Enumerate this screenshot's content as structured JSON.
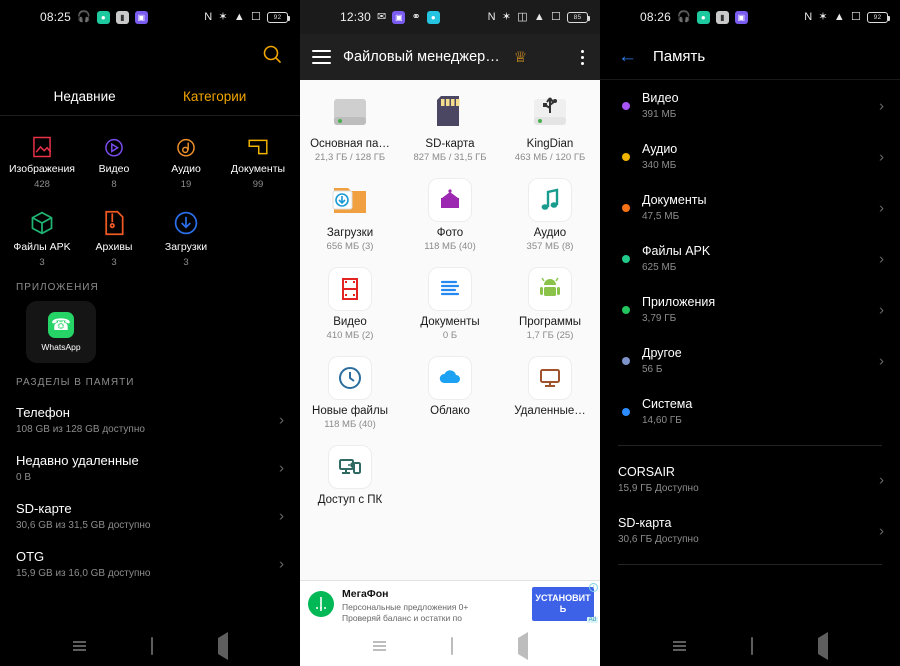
{
  "panel1": {
    "status": {
      "time": "08:25",
      "battery": "92",
      "left_icons": [
        "headphone-icon",
        "spotify-chip",
        "mail-chip",
        "app-chip"
      ],
      "right_icons": [
        "nfc-icon",
        "bluetooth-icon",
        "wifi-icon",
        "screenshot-icon",
        "battery-icon"
      ]
    },
    "search_label": "search-icon",
    "tabs": [
      {
        "label": "Недавние",
        "active": false
      },
      {
        "label": "Категории",
        "active": true
      }
    ],
    "categories": [
      {
        "label": "Изображения",
        "count": "428",
        "color": "#e8334a",
        "icon": "image-icon"
      },
      {
        "label": "Видео",
        "count": "8",
        "color": "#7a4df0",
        "icon": "video-icon"
      },
      {
        "label": "Аудио",
        "count": "19",
        "color": "#f0902a",
        "icon": "audio-icon"
      },
      {
        "label": "Документы",
        "count": "99",
        "color": "#f0b400",
        "icon": "document-icon"
      },
      {
        "label": "Файлы APK",
        "count": "3",
        "color": "#1fb472",
        "icon": "apk-icon"
      },
      {
        "label": "Архивы",
        "count": "3",
        "color": "#f05a22",
        "icon": "archive-icon"
      },
      {
        "label": "Загрузки",
        "count": "3",
        "color": "#2b6fe8",
        "icon": "download-icon"
      }
    ],
    "apps_header": "ПРИЛОЖЕНИЯ",
    "apps": [
      {
        "name": "WhatsApp",
        "icon": "whatsapp-icon",
        "color": "#25D366"
      }
    ],
    "storage_header": "РАЗДЕЛЫ В ПАМЯТИ",
    "storage": [
      {
        "title": "Телефон",
        "sub": "108 GB из 128 GB доступно"
      },
      {
        "title": "Недавно удаленные",
        "sub": "0 B"
      },
      {
        "title": "SD-карте",
        "sub": "30,6 GB из 31,5 GB доступно"
      },
      {
        "title": "OTG",
        "sub": "15,9 GB из 16,0 GB доступно"
      }
    ]
  },
  "panel2": {
    "status": {
      "time": "12:30",
      "battery": "85",
      "left_icons": [
        "mail-icon",
        "app-chip",
        "bike-icon",
        "telegram-chip"
      ],
      "right_icons": [
        "nfc-icon",
        "bluetooth-icon",
        "vibrate-icon",
        "wifi-icon",
        "screenshot-icon",
        "battery-icon"
      ]
    },
    "appbar": {
      "menu": "menu-icon",
      "title": "Файловый менеджер…",
      "crown": "crown-icon",
      "overflow": "more-icon"
    },
    "drives": [
      {
        "label": "Основная па…",
        "sub": "21,3 ГБ / 128 ГБ",
        "icon": "hdd-icon"
      },
      {
        "label": "SD-карта",
        "sub": "827 МБ / 31,5 ГБ",
        "icon": "sdcard-icon"
      },
      {
        "label": "KingDian",
        "sub": "463 МБ / 120 ГБ",
        "icon": "usb-drive-icon"
      }
    ],
    "items": [
      {
        "label": "Загрузки",
        "sub": "656 МБ (3)",
        "icon": "downloads-folder-icon",
        "color": "#f0a040"
      },
      {
        "label": "Фото",
        "sub": "118 МБ (40)",
        "icon": "photo-icon",
        "color": "#9c27b0"
      },
      {
        "label": "Аудио",
        "sub": "357 МБ (8)",
        "icon": "music-note-icon",
        "color": "#179c8e"
      },
      {
        "label": "Видео",
        "sub": "410 МБ (2)",
        "icon": "film-icon",
        "color": "#e32222"
      },
      {
        "label": "Документы",
        "sub": "0 Б",
        "icon": "document-lines-icon",
        "color": "#2489f0"
      },
      {
        "label": "Программы",
        "sub": "1,7 ГБ (25)",
        "icon": "android-icon",
        "color": "#8bc34a"
      },
      {
        "label": "Новые файлы",
        "sub": "118 МБ (40)",
        "icon": "clock-icon",
        "color": "#2b6e9e"
      },
      {
        "label": "Облако",
        "sub": "",
        "icon": "cloud-icon",
        "color": "#1da1f2"
      },
      {
        "label": "Удаленные…",
        "sub": "",
        "icon": "monitor-icon",
        "color": "#a0522d"
      },
      {
        "label": "Доступ с ПК",
        "sub": "",
        "icon": "pc-share-icon",
        "color": "#2f6b63"
      }
    ],
    "ad": {
      "title": "МегаФон",
      "line1": "Персональные предложения 0+",
      "line2": "Проверяй баланс и остатки по",
      "button": "УСТАНОВИТЬ",
      "info": "i",
      "tag": "Ad"
    }
  },
  "panel3": {
    "status": {
      "time": "08:26",
      "battery": "92",
      "left_icons": [
        "headphone-icon",
        "spotify-chip",
        "mail-chip",
        "app-chip"
      ],
      "right_icons": [
        "nfc-icon",
        "bluetooth-icon",
        "wifi-icon",
        "screenshot-icon",
        "battery-icon"
      ]
    },
    "appbar": {
      "back": "back-arrow-icon",
      "title": "Память"
    },
    "memory": [
      {
        "name": "Видео",
        "size": "391 МБ",
        "color": "#a855f7"
      },
      {
        "name": "Аудио",
        "size": "340 МБ",
        "color": "#f0b400"
      },
      {
        "name": "Документы",
        "size": "47,5 МБ",
        "color": "#f97316"
      },
      {
        "name": "Файлы APK",
        "size": "625 МБ",
        "color": "#22c98a"
      },
      {
        "name": "Приложения",
        "size": "3,79 ГБ",
        "color": "#22c55e"
      },
      {
        "name": "Другое",
        "size": "56 Б",
        "color": "#7d93c9"
      },
      {
        "name": "Система",
        "size": "14,60  ГБ",
        "color": "#2b8cff"
      }
    ],
    "volumes": [
      {
        "name": "CORSAIR",
        "sub": "15,9 ГБ Доступно"
      },
      {
        "name": "SD-карта",
        "sub": "30,6 ГБ Доступно"
      }
    ]
  },
  "navbar": {
    "recents": "recents-icon",
    "home": "home-icon",
    "back": "back-icon"
  }
}
